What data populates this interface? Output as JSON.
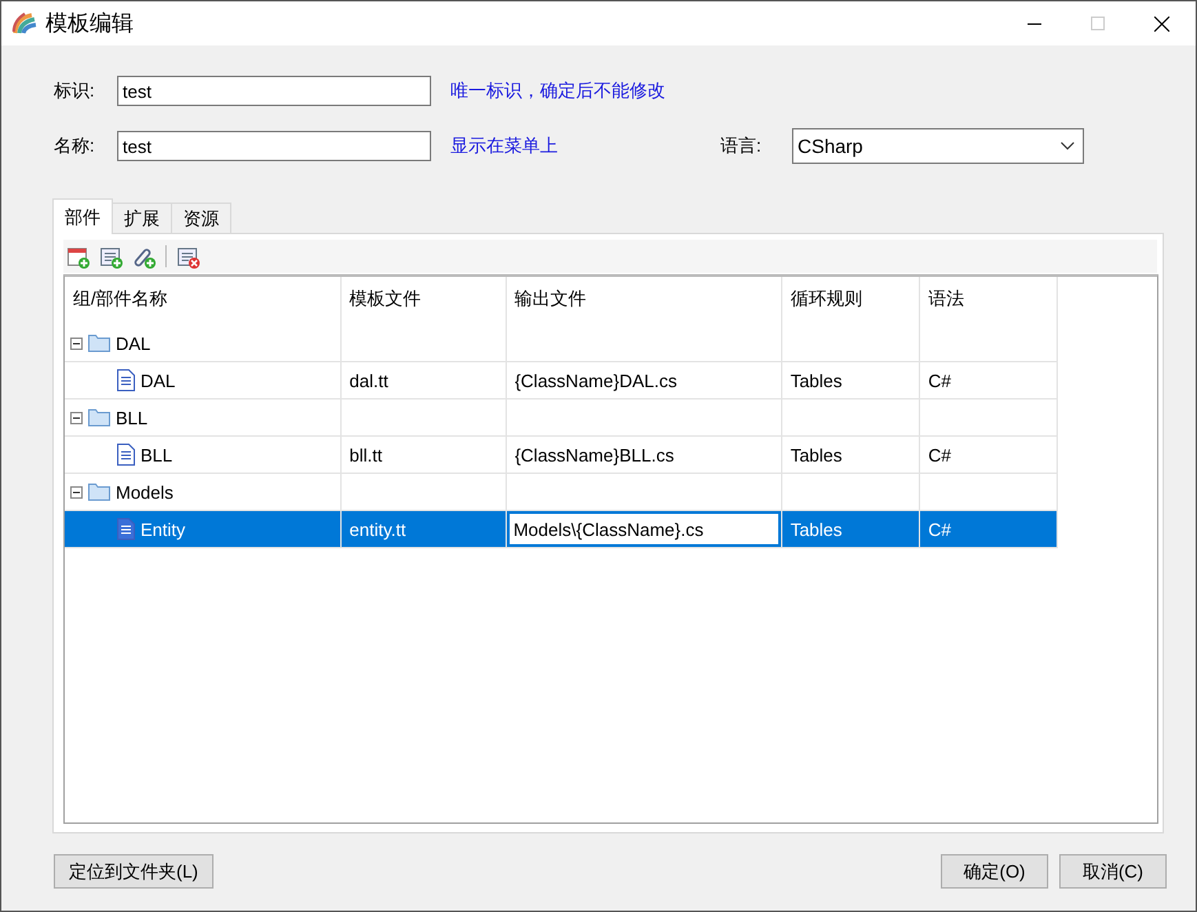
{
  "window": {
    "title": "模板编辑",
    "maximize_disabled": true
  },
  "form": {
    "id_field": {
      "label": "标识:",
      "value": "test",
      "hint": "唯一标识，确定后不能修改"
    },
    "name_field": {
      "label": "名称:",
      "value": "test",
      "hint": "显示在菜单上"
    },
    "language": {
      "label": "语言:",
      "value": "CSharp"
    }
  },
  "tabs": [
    {
      "label": "部件",
      "selected": true
    },
    {
      "label": "扩展",
      "selected": false
    },
    {
      "label": "资源",
      "selected": false
    }
  ],
  "toolbar": [
    {
      "kind": "add-group"
    },
    {
      "kind": "add-part"
    },
    {
      "kind": "add-link"
    },
    {
      "kind": "separator"
    },
    {
      "kind": "delete"
    }
  ],
  "table": {
    "columns": [
      "组/部件名称",
      "模板文件",
      "输出文件",
      "循环规则",
      "语法"
    ],
    "rows": [
      {
        "kind": "group",
        "name": "DAL",
        "expanded": true,
        "children": [
          {
            "name": "DAL",
            "template": "dal.tt",
            "output": "{ClassName}DAL.cs",
            "loop": "Tables",
            "syntax": "C#",
            "selected": false,
            "editing": false
          }
        ]
      },
      {
        "kind": "group",
        "name": "BLL",
        "expanded": true,
        "children": [
          {
            "name": "BLL",
            "template": "bll.tt",
            "output": "{ClassName}BLL.cs",
            "loop": "Tables",
            "syntax": "C#",
            "selected": false,
            "editing": false
          }
        ]
      },
      {
        "kind": "group",
        "name": "Models",
        "expanded": true,
        "children": [
          {
            "name": "Entity",
            "template": "entity.tt",
            "output": "Models\\{ClassName}.cs",
            "loop": "Tables",
            "syntax": "C#",
            "selected": true,
            "editing": true
          }
        ]
      }
    ]
  },
  "buttons": {
    "locate": "定位到文件夹(L)",
    "ok": "确定(O)",
    "cancel": "取消(C)"
  }
}
